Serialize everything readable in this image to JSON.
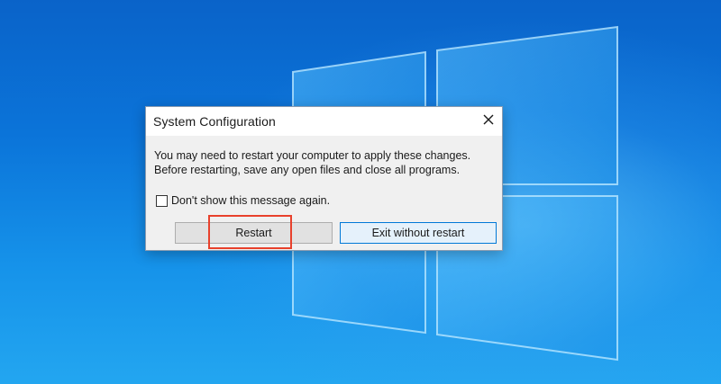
{
  "dialog": {
    "title": "System Configuration",
    "message_line1": "You may need to restart your computer to apply these changes.",
    "message_line2": "Before restarting, save any open files and close all programs.",
    "checkbox_label": "Don't show this message again.",
    "checkbox_checked": false,
    "restart_label": "Restart",
    "exit_label": "Exit without restart",
    "close_icon": "close-icon"
  },
  "colors": {
    "highlight": "#e8412c",
    "focus_border": "#0078d7",
    "desktop": "#0b74d9"
  }
}
